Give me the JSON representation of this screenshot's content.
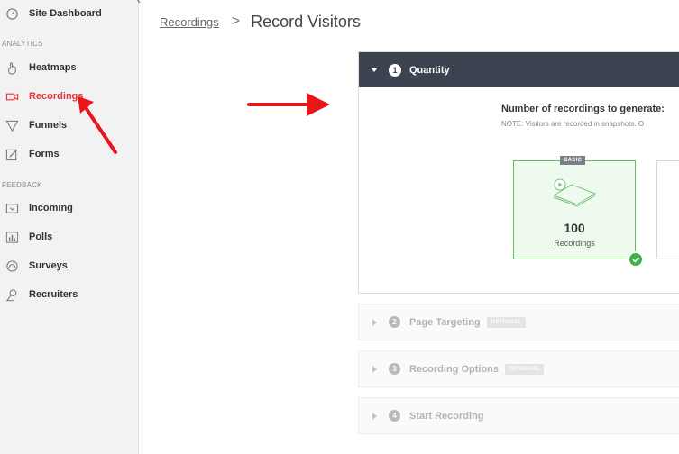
{
  "sidebar": {
    "items": [
      {
        "label": "Site Dashboard",
        "icon": "dashboard-icon"
      },
      {
        "label": "Heatmaps",
        "icon": "hand-pointer-icon"
      },
      {
        "label": "Recordings",
        "icon": "video-camera-icon",
        "active": true
      },
      {
        "label": "Funnels",
        "icon": "funnel-icon"
      },
      {
        "label": "Forms",
        "icon": "form-edit-icon"
      },
      {
        "label": "Incoming",
        "icon": "inbox-icon"
      },
      {
        "label": "Polls",
        "icon": "bar-chart-icon"
      },
      {
        "label": "Surveys",
        "icon": "survey-icon"
      },
      {
        "label": "Recruiters",
        "icon": "user-icon"
      }
    ],
    "sections": {
      "analytics": "ANALYTICS",
      "feedback": "FEEDBACK"
    }
  },
  "breadcrumb": {
    "link": "Recordings",
    "separator": ">",
    "title": "Record Visitors"
  },
  "quantity": {
    "step": "1",
    "title": "Quantity",
    "heading": "Number of recordings to generate:",
    "note": "NOTE: Visitors are recorded in snapshots. O",
    "card": {
      "badge": "BASIC",
      "count": "100",
      "unit": "Recordings"
    }
  },
  "steps": [
    {
      "num": "2",
      "label": "Page Targeting",
      "tag": "OPTIONAL"
    },
    {
      "num": "3",
      "label": "Recording Options",
      "tag": "OPTIONAL"
    },
    {
      "num": "4",
      "label": "Start Recording",
      "tag": ""
    }
  ],
  "colors": {
    "accent": "#e8323c",
    "header": "#3d4451",
    "selected_border": "#5cc15c",
    "check": "#3bb34a",
    "arrow": "#e8161b"
  }
}
